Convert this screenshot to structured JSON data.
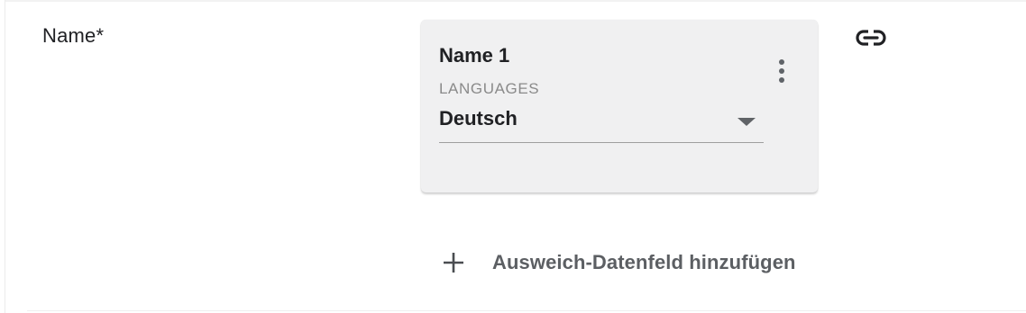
{
  "field": {
    "label": "Name*"
  },
  "card": {
    "title": "Name 1",
    "select_label": "LANGUAGES",
    "select_value": "Deutsch"
  },
  "add_fallback": {
    "label": "Ausweich-Datenfeld hinzufügen"
  },
  "icons": {
    "link": "link-icon",
    "more": "more-vert-icon",
    "dropdown": "arrow-drop-down-icon",
    "add": "plus-icon"
  },
  "colors": {
    "card_background": "#f0f0f1",
    "text_primary": "#202124",
    "text_secondary": "#8a8a8a",
    "icon": "#5f6368"
  }
}
